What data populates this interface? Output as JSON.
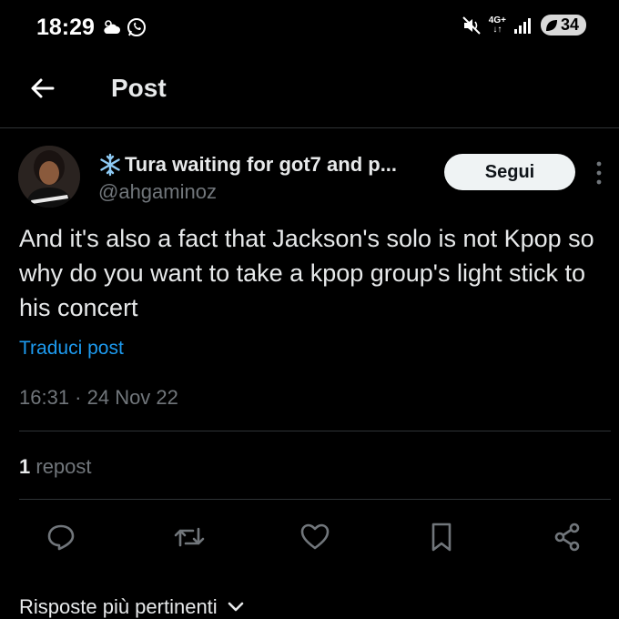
{
  "status_bar": {
    "time": "18:29",
    "network": "4G+",
    "battery": "34",
    "left_icons": [
      "weather-cloud-icon",
      "whatsapp-icon"
    ],
    "right_icons": [
      "mute-icon",
      "network-4g-icon",
      "signal-icon",
      "battery-icon"
    ]
  },
  "header": {
    "title": "Post",
    "back_icon": "arrow-left-icon"
  },
  "post": {
    "author_name": "Tura waiting for got7 and p...",
    "author_emoji_icon": "snowflake-icon",
    "handle": "@ahgaminoz",
    "follow_label": "Segui",
    "text": "And it's also a fact that Jackson's solo is not Kpop so why do you want to take a kpop group's light stick to his concert",
    "translate_label": "Traduci post",
    "meta": "16:31 · 24 Nov 22",
    "repost_count": "1",
    "repost_label": "repost"
  },
  "actions": [
    "reply-icon",
    "repost-icon",
    "like-icon",
    "bookmark-icon",
    "share-icon"
  ],
  "replies_sort": {
    "label": "Risposte più pertinenti"
  },
  "colors": {
    "background": "#000000",
    "text": "#e7e9ea",
    "muted": "#71767b",
    "link": "#1d9bf0",
    "divider": "#2f3336"
  }
}
